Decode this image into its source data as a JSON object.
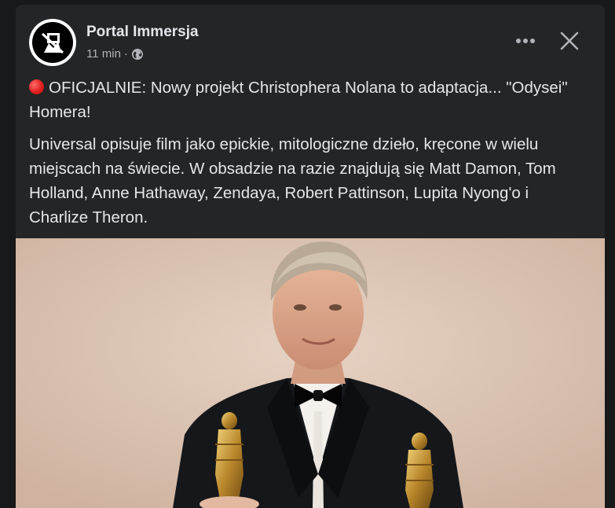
{
  "post": {
    "page_name": "Portal Immersja",
    "time": "11 min",
    "separator": "·",
    "privacy_icon": "globe-icon",
    "more_icon": "more-options-icon",
    "close_icon": "close-icon",
    "headline_icon": "red-circle-icon",
    "headline": "OFICJALNIE: Nowy projekt Christophera Nolana to adaptacja... \"Odysei\" Homera!",
    "body": "Universal opisuje film jako epickie, mitologiczne dzieło, kręcone w wielu miejscach na świecie. W obsadzie na razie znajdują się Matt Damon, Tom Holland, Anne Hathaway, Zendaya, Robert Pattinson, Lupita Nyong'o i Charlize Theron."
  },
  "colors": {
    "background": "#18191a",
    "card": "#242526",
    "primary_text": "#e4e6eb",
    "secondary_text": "#b0b3b8",
    "photo_backdrop": "#dbc4b4"
  }
}
